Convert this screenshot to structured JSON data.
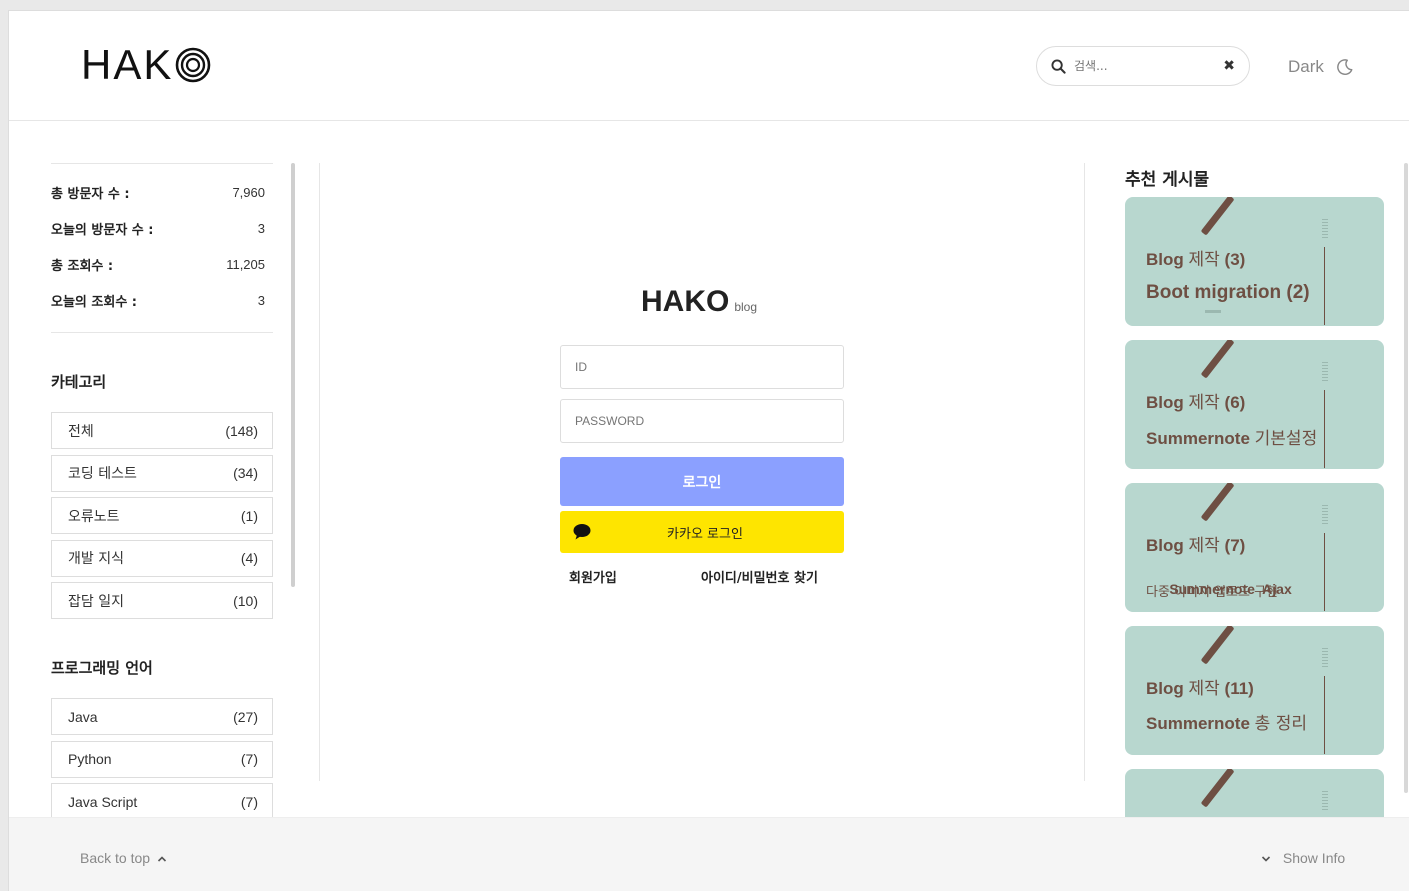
{
  "header": {
    "logo_text": "HAK",
    "search_placeholder": "검색...",
    "clear_icon": "close-icon",
    "theme_label": "Dark",
    "theme_icon": "moon-icon"
  },
  "stats": [
    {
      "label": "총 방문자 수 :",
      "value": "7,960"
    },
    {
      "label": "오늘의 방문자 수 :",
      "value": "3"
    },
    {
      "label": "총 조회수 :",
      "value": "11,205"
    },
    {
      "label": "오늘의 조회수 :",
      "value": "3"
    }
  ],
  "categories": {
    "title": "카테고리",
    "items": [
      {
        "name": "전체",
        "count": "(148)"
      },
      {
        "name": "코딩 테스트",
        "count": "(34)"
      },
      {
        "name": "오류노트",
        "count": "(1)"
      },
      {
        "name": "개발 지식",
        "count": "(4)"
      },
      {
        "name": "잡담 일지",
        "count": "(10)"
      }
    ]
  },
  "languages": {
    "title": "프로그래밍 언어",
    "items": [
      {
        "name": "Java",
        "count": "(27)"
      },
      {
        "name": "Python",
        "count": "(7)"
      },
      {
        "name": "Java Script",
        "count": "(7)"
      }
    ]
  },
  "login": {
    "brand": "HAKO",
    "brand_sub": "blog",
    "id_placeholder": "ID",
    "password_placeholder": "PASSWORD",
    "login_button": "로그인",
    "kakao_button": "카카오 로그인",
    "signup_link": "회원가입",
    "find_link": "아이디/비밀번호 찾기"
  },
  "recommended": {
    "title": "추천 게시물",
    "cards": [
      {
        "line1_en": "Blog",
        "line1_ko": "제작",
        "line1_num": "(3)",
        "line2_en": "Boot migration (2)",
        "line2_ko": "",
        "line3": ""
      },
      {
        "line1_en": "Blog",
        "line1_ko": "제작",
        "line1_num": "(6)",
        "line2_en": "Summernote",
        "line2_ko": "기본설정",
        "line3": ""
      },
      {
        "line1_en": "Blog",
        "line1_ko": "제작",
        "line1_num": "(7)",
        "line2_en": "Summernote  Ajax",
        "line2_ko": "",
        "line3": "다중 이미지 업로드 구현"
      },
      {
        "line1_en": "Blog",
        "line1_ko": "제작",
        "line1_num": "(11)",
        "line2_en": "Summernote",
        "line2_ko": "총 정리",
        "line3": ""
      }
    ]
  },
  "footer": {
    "back_to_top": "Back to top",
    "show_info": "Show Info"
  },
  "colors": {
    "accent": "#8ba0ff",
    "kakao": "#fee500",
    "card_bg": "#b8d7cf",
    "card_text": "#6e4f43"
  }
}
